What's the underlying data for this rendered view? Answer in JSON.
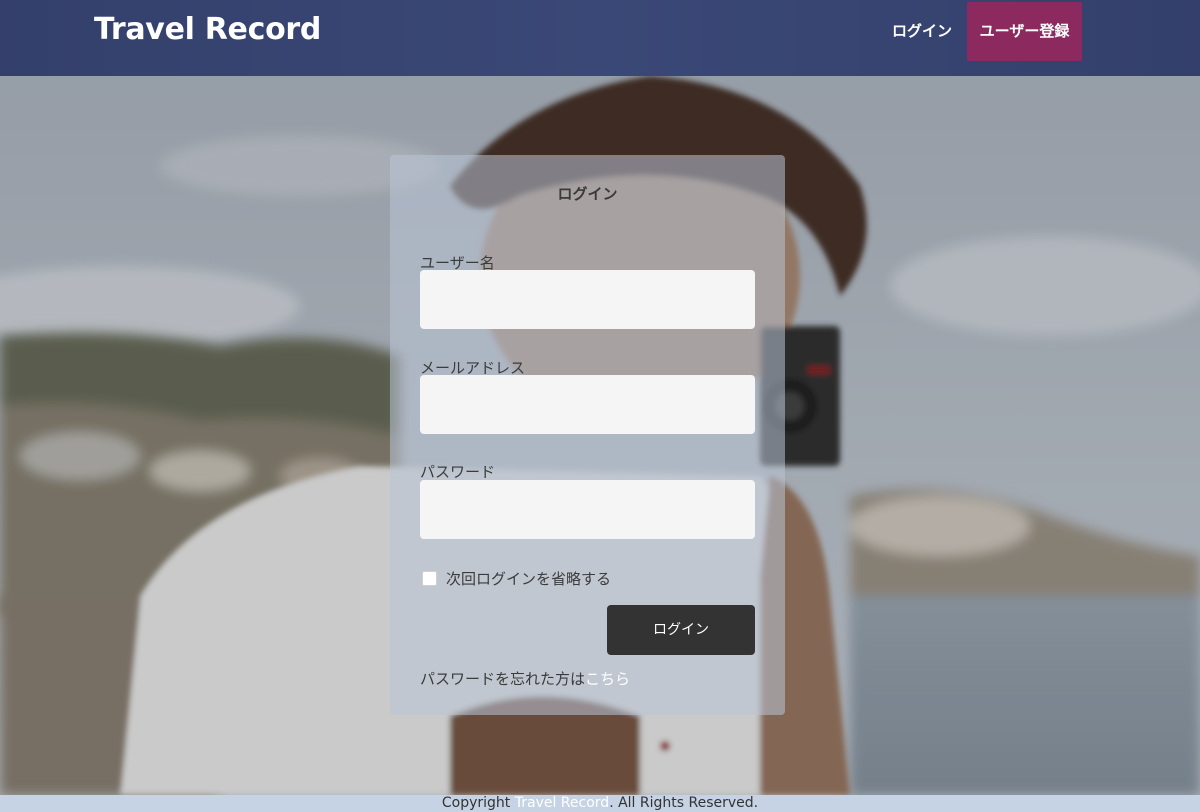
{
  "header": {
    "brand": "Travel Record",
    "nav_login": "ログイン",
    "nav_signup": "ユーザー登録"
  },
  "login_form": {
    "title": "ログイン",
    "username_label": "ユーザー名",
    "username_value": "",
    "email_label": "メールアドレス",
    "email_value": "",
    "password_label": "パスワード",
    "password_value": "",
    "remember_label": "次回ログインを省略する",
    "remember_checked": false,
    "submit_label": "ログイン",
    "forgot_text": "パスワードを忘れた方は",
    "forgot_link": "こちら"
  },
  "footer": {
    "prefix": "Copyright ",
    "site_name": "Travel Record",
    "suffix": ". All Rights Reserved."
  },
  "colors": {
    "header_bg": "#34406b",
    "signup_bg": "#8c2a5f",
    "submit_bg": "#333333",
    "footer_bg": "#c6d3e4"
  }
}
